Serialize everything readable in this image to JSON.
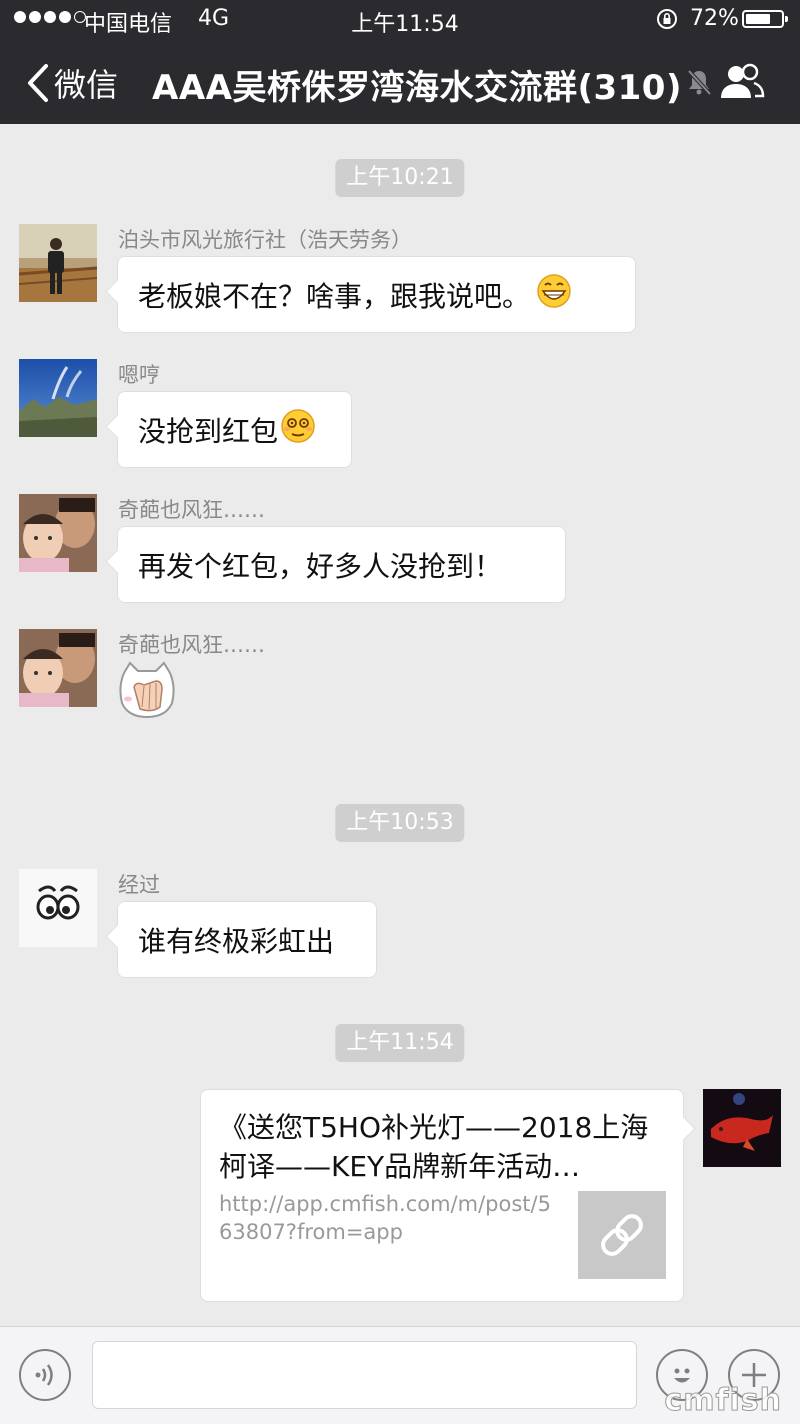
{
  "status_bar": {
    "carrier": "中国电信",
    "network": "4G",
    "time": "上午11:54",
    "battery": "72%",
    "battery_level": 0.72
  },
  "nav": {
    "back_label": "微信",
    "title": "AAA吴桥侏罗湾海水交流群(310)"
  },
  "chat": {
    "timestamps": [
      "上午10:21",
      "上午10:53",
      "上午11:54"
    ],
    "messages": [
      {
        "sender": "泊头市风光旅行社（浩天劳务）",
        "text": "老板娘不在？啥事，跟我说吧。",
        "emoji": "grinning-emoji"
      },
      {
        "sender": "嗯哼",
        "text": "没抢到红包",
        "emoji": "dizzy-face-emoji"
      },
      {
        "sender": "奇葩也风狂……",
        "text": "再发个红包，好多人没抢到！"
      },
      {
        "sender": "奇葩也风狂……",
        "sticker": "cat-facepalm-sticker"
      },
      {
        "sender": "经过",
        "text": "谁有终极彩虹出"
      }
    ],
    "link_card": {
      "title": "《送您T5HO补光灯——2018上海柯译——KEY品牌新年活动…",
      "url": "http://app.cmfish.com/m/post/563807?from=app",
      "thumb_icon": "link-icon"
    }
  },
  "input_bar": {
    "watermark": "cmfish"
  }
}
